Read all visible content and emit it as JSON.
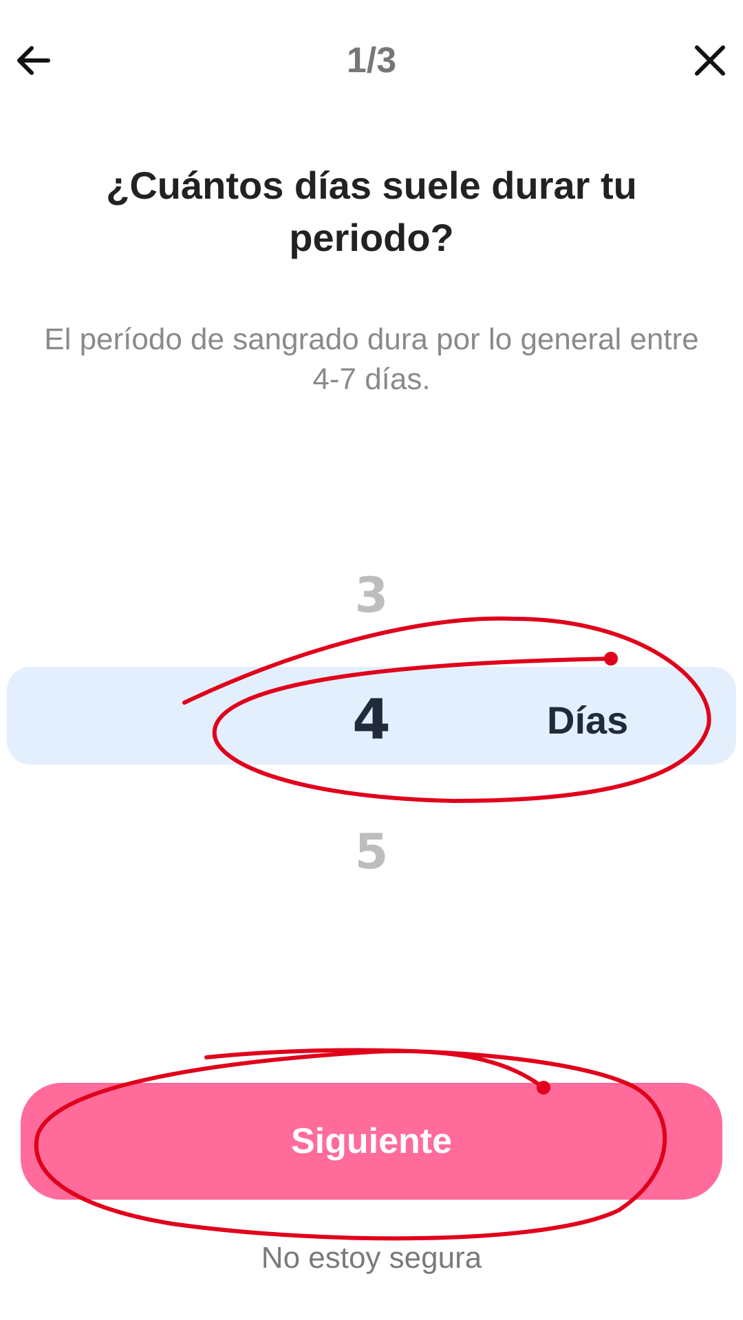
{
  "header": {
    "step": "1/3",
    "back_icon": "arrow-left-icon",
    "close_icon": "close-icon"
  },
  "question": {
    "title": "¿Cuántos días suele durar tu periodo?",
    "subtitle": "El período de sangrado dura por lo general entre 4-7 días."
  },
  "picker": {
    "prev": "3",
    "selected": "4",
    "next": "5",
    "unit": "Días",
    "highlight_color": "#e3effc"
  },
  "actions": {
    "next_label": "Siguiente",
    "unsure_label": "No estoy segura",
    "next_color": "#ff6b9a"
  },
  "annotation": {
    "color": "#e0001b"
  }
}
